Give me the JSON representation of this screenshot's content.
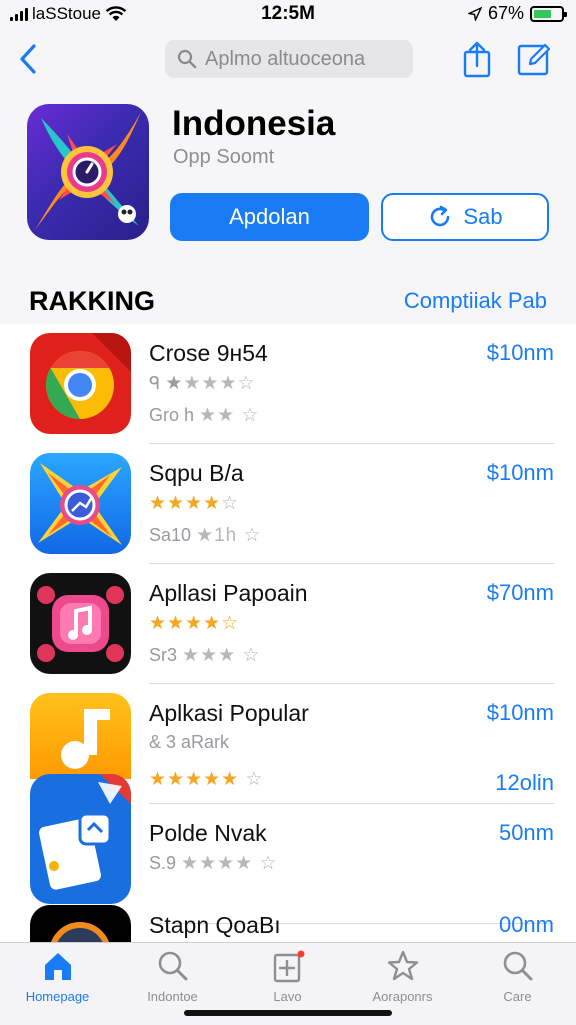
{
  "status": {
    "carrier": "laSStoue",
    "time": "12:5M",
    "battery": "67%",
    "battery_level": 0.67
  },
  "nav": {
    "search_placeholder": "Aplmo altuoceona"
  },
  "app": {
    "title": "Indonesia",
    "subtitle": "Opp Soomt",
    "primary_button": "Apdolan",
    "secondary_button": "Sab"
  },
  "section": {
    "title": "RAKKING",
    "link": "Comptiiak Pab"
  },
  "apps": [
    {
      "name": "Crose 9н54",
      "line2": "ᑫ",
      "line3": "Gro h",
      "price": "$10nm",
      "price2": "",
      "rating": 1,
      "stars_row": 2,
      "icon": "chrome-icon"
    },
    {
      "name": "Sqpu B/a",
      "line2": "",
      "line3": "Sa10",
      "price": "$10nm",
      "price2": "",
      "rating": 4,
      "stars_row": 2,
      "icon": "compass-icon"
    },
    {
      "name": "Apllasi Papoain",
      "line2": "",
      "line3": "Sr3",
      "price": "$70nm",
      "price2": "",
      "rating": 4,
      "stars_row": 2,
      "icon": "music-icon"
    },
    {
      "name": "Aplkasi Popular",
      "line2": "& 3 aRark",
      "line3": "",
      "price": "$10nm",
      "price2": "12olin",
      "rating": 5,
      "stars_row": 3,
      "icon": "music-note-icon"
    },
    {
      "name": "Polde Nvak",
      "line2": "S.9",
      "line3": "",
      "price": "50nm",
      "price2": "",
      "rating": 2,
      "stars_row": 2,
      "icon": "document-icon"
    },
    {
      "name": "Stapn QoaBı",
      "line2": "",
      "line3": "",
      "price": "00nm",
      "price2": "",
      "rating": 0,
      "stars_row": 0,
      "icon": "game-icon"
    }
  ],
  "tabs": [
    {
      "label": "Homepage",
      "icon": "home-icon",
      "active": true
    },
    {
      "label": "Indontoe",
      "icon": "search-icon",
      "active": false
    },
    {
      "label": "Lavo",
      "icon": "add-icon",
      "active": false
    },
    {
      "label": "Aoraponrs",
      "icon": "star-icon",
      "active": false
    },
    {
      "label": "Care",
      "icon": "search-icon",
      "active": false
    }
  ],
  "colors": {
    "accent": "#1a7cf5",
    "star": "#f5a623",
    "battery": "#34c759"
  }
}
